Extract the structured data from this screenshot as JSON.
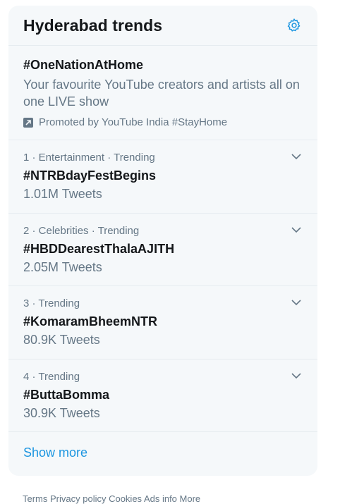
{
  "panel": {
    "title": "Hyderabad trends",
    "settings_icon": "gear-icon"
  },
  "promoted": {
    "hashtag": "#OneNationAtHome",
    "description": "Your favourite YouTube creators and artists all on one LIVE show",
    "promoted_by": "Promoted by YouTube India #StayHome",
    "icon": "promoted-arrow-icon"
  },
  "trends": [
    {
      "meta": "1 · Entertainment · Trending",
      "name": "#NTRBdayFestBegins",
      "count": "1.01M Tweets"
    },
    {
      "meta": "2 · Celebrities · Trending",
      "name": "#HBDDearestThalaAJITH",
      "count": "2.05M Tweets"
    },
    {
      "meta": "3 · Trending",
      "name": "#KomaramBheemNTR",
      "count": "80.9K Tweets"
    },
    {
      "meta": "4 · Trending",
      "name": "#ButtaBomma",
      "count": "30.9K Tweets"
    }
  ],
  "show_more": "Show more",
  "footer": {
    "text": "Terms  Privacy policy  Cookies  Ads info  More"
  },
  "colors": {
    "accent": "#1b95e0",
    "card_bg": "#f5f8fa",
    "muted": "#657786",
    "divider": "#e6ecf0"
  }
}
